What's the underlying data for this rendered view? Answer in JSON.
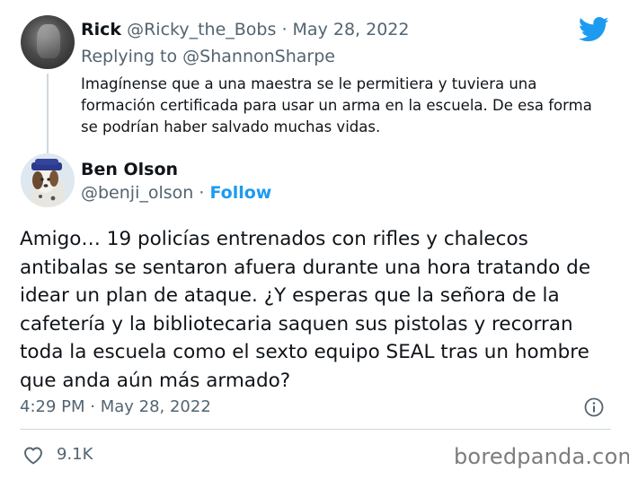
{
  "reply_to_tweet": {
    "author_name": "Rick",
    "author_handle": "@Ricky_the_Bobs",
    "separator": "·",
    "date": "May 28, 2022",
    "replying_prefix": "Replying to",
    "replying_handle": "@ShannonSharpe",
    "text": "Imagínense que a una maestra se le permitiera y tuviera una formación certificada para usar un arma en la escuela. De esa forma se podrían haber salvado muchas vidas."
  },
  "main_tweet": {
    "author_name": "Ben Olson",
    "author_handle": "@benji_olson",
    "separator": "·",
    "follow_label": "Follow",
    "text": "Amigo… 19 policías entrenados con rifles y chalecos antibalas se sentaron afuera durante una hora tratando de idear un plan de ataque. ¿Y esperas que la señora de la cafetería y la bibliotecaria saquen sus pistolas y recorran toda la escuela como el sexto equipo SEAL tras un hombre que anda aún más armado?",
    "timestamp": "4:29 PM · May 28, 2022",
    "like_count": "9.1K"
  },
  "watermark": "boredpanda.com",
  "icons": {
    "brand": "twitter-bird-icon",
    "info": "info-icon",
    "like": "heart-icon"
  },
  "colors": {
    "accent": "#1d9bf0",
    "secondary_text": "#536471",
    "primary_text": "#0f1419",
    "divider": "#cfd9de"
  }
}
